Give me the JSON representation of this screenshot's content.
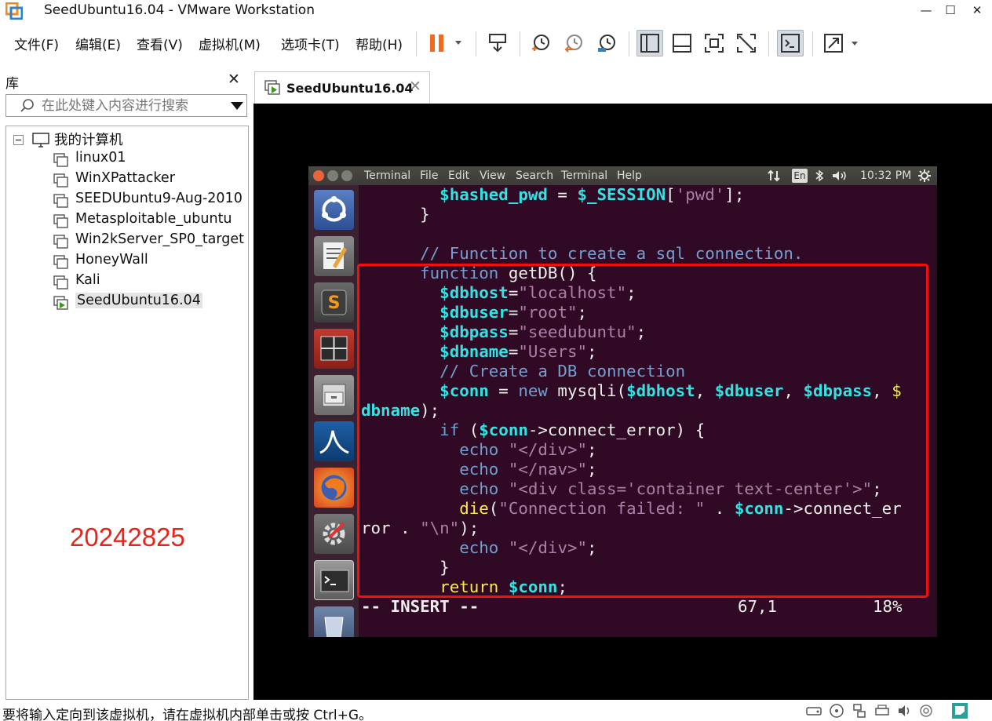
{
  "window": {
    "title": "SeedUbuntu16.04 - VMware Workstation",
    "min_glyph": "—",
    "max_glyph": "☐",
    "close_glyph": "✕"
  },
  "menu": {
    "items": [
      "文件(F)",
      "编辑(E)",
      "查看(V)",
      "虚拟机(M)",
      "选项卡(T)",
      "帮助(H)"
    ]
  },
  "library": {
    "title": "库",
    "close_glyph": "✕",
    "search_placeholder": "在此处键入内容进行搜索",
    "root": "我的计算机",
    "vms": [
      "linux01",
      "WinXPattacker",
      "SEEDUbuntu9-Aug-2010",
      "Metasploitable_ubuntu",
      "Win2kServer_SP0_target",
      "HoneyWall",
      "Kali",
      "SeedUbuntu16.04"
    ],
    "selected_vm": "SeedUbuntu16.04",
    "watermark": "20242825"
  },
  "tab": {
    "label": "SeedUbuntu16.04",
    "close_glyph": "✕"
  },
  "guest": {
    "menu": [
      "Terminal",
      "File",
      "Edit",
      "View",
      "Search",
      "Terminal",
      "Help"
    ],
    "tray": {
      "lang": "En",
      "time": "10:32 PM"
    },
    "editor": {
      "lines": [
        "        $hashed_pwd = $_SESSION['pwd'];",
        "      }",
        "",
        "      // Function to create a sql connection.",
        "      function getDB() {",
        "        $dbhost=\"localhost\";",
        "        $dbuser=\"root\";",
        "        $dbpass=\"seedubuntu\";",
        "        $dbname=\"Users\";",
        "        // Create a DB connection",
        "        $conn = new mysqli($dbhost, $dbuser, $dbpass, $",
        "dbname);",
        "        if ($conn->connect_error) {",
        "          echo \"</div>\";",
        "          echo \"</nav>\";",
        "          echo \"<div class='container text-center'>\";",
        "          die(\"Connection failed: \" . $conn->connect_er",
        "ror . \"\\n\");",
        "          echo \"</div>\";",
        "        }",
        "        return $conn;"
      ],
      "mode": "-- INSERT --",
      "position": "67,1",
      "percent": "18%"
    }
  },
  "statusbar": {
    "text": "要将输入定向到该虚拟机，请在虚拟机内部单击或按 Ctrl+G。"
  },
  "colors": {
    "terminal_bg": "#300a24",
    "highlight_box": "#f01010",
    "watermark": "#e8241a",
    "pause_orange": "#f26b1d"
  }
}
